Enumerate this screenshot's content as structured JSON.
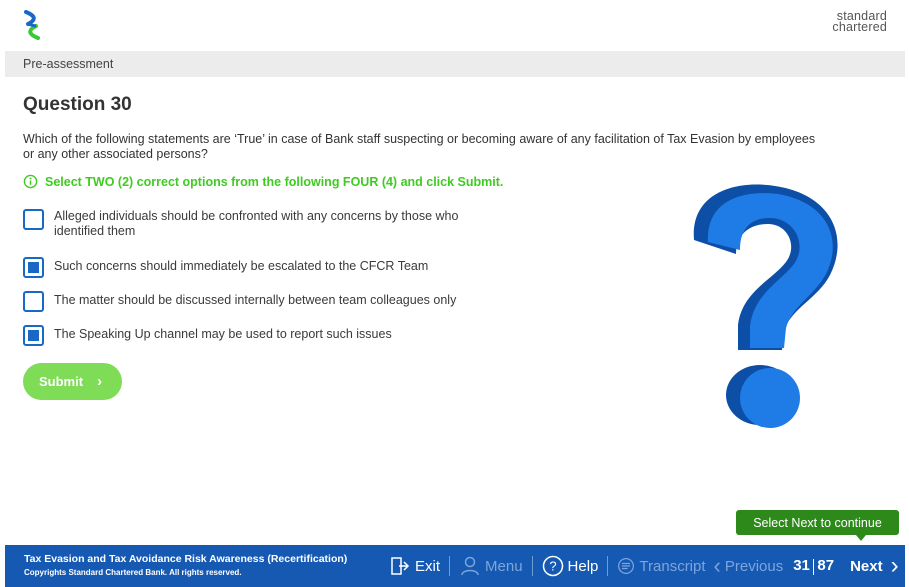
{
  "header": {
    "brand_line1": "standard",
    "brand_line2": "chartered"
  },
  "section": {
    "title": "Pre-assessment"
  },
  "question": {
    "title": "Question 30",
    "text": "Which of the following statements are ‘True’ in case of Bank staff suspecting or becoming aware of any facilitation of Tax Evasion by employees or any other associated persons?",
    "instruction": "Select TWO (2) correct options from the following FOUR (4) and click Submit."
  },
  "options": [
    {
      "label": "Alleged individuals should be confronted with any concerns by those who identified them",
      "checked": false
    },
    {
      "label": "Such concerns should immediately be escalated to the CFCR Team",
      "checked": true
    },
    {
      "label": "The matter should be discussed internally between team colleagues only",
      "checked": false
    },
    {
      "label": "The Speaking Up channel may be used to report such issues",
      "checked": true
    }
  ],
  "submit": {
    "label": "Submit"
  },
  "tooltip": {
    "text": "Select Next to continue"
  },
  "footer": {
    "course_title": "Tax Evasion and Tax Avoidance Risk Awareness (Recertification)",
    "copyright": "Copyrights Standard Chartered Bank. All rights reserved.",
    "exit_label": "Exit",
    "menu_label": "Menu",
    "help_label": "Help",
    "transcript_label": "Transcript",
    "previous_label": "Previous",
    "current_page": "31",
    "total_pages": "87",
    "next_label": "Next"
  },
  "colors": {
    "accent_blue": "#1559b3",
    "checkbox_blue": "#1a68c6",
    "instruction_green": "#3fcb22",
    "submit_green": "#7fdc56",
    "tooltip_green": "#2d8a1a"
  }
}
